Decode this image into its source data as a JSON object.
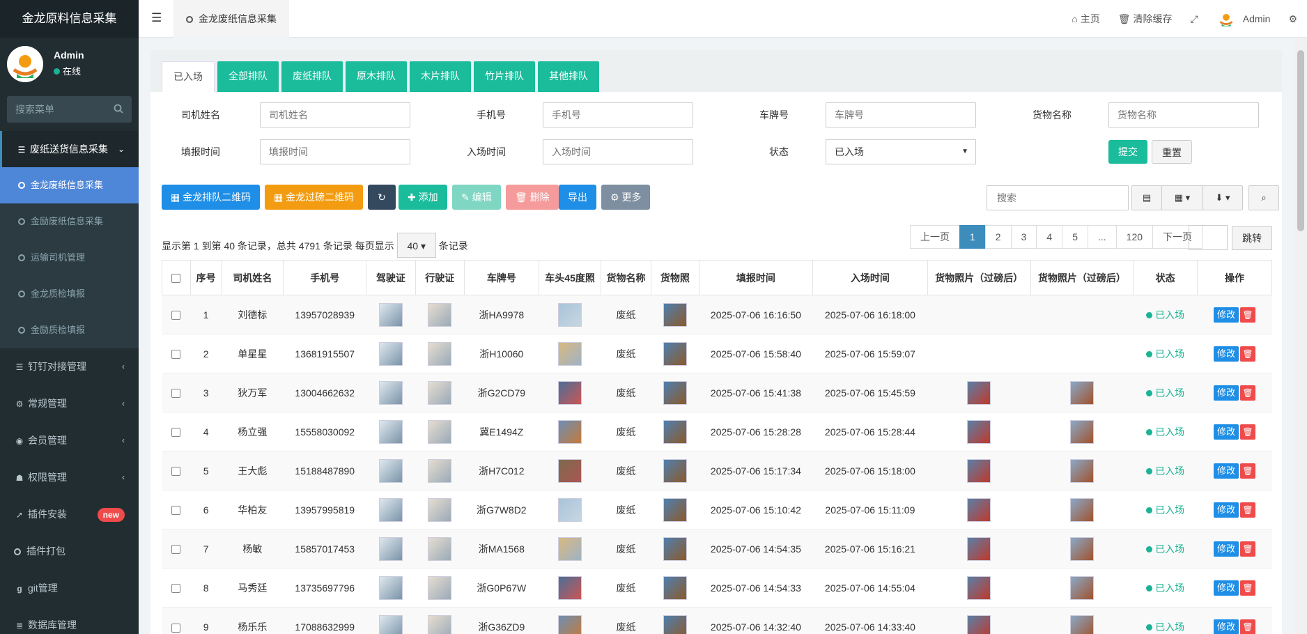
{
  "sidebar": {
    "brand": "金龙原料信息采集",
    "user_name": "Admin",
    "user_status": "在线",
    "search_placeholder": "搜索菜单",
    "active_group": "废纸送货信息采集",
    "sub_items": [
      "金龙废纸信息采集",
      "金励废纸信息采集",
      "运输司机管理",
      "金龙质检填报",
      "金励质检填报"
    ],
    "items": [
      {
        "label": "钉钉对接管理",
        "icon": "list-icon"
      },
      {
        "label": "常规管理",
        "icon": "cogs-icon"
      },
      {
        "label": "会员管理",
        "icon": "user-circle-icon"
      },
      {
        "label": "权限管理",
        "icon": "group-icon"
      },
      {
        "label": "插件安装",
        "icon": "rocket-icon",
        "badge": "new"
      },
      {
        "label": "插件打包",
        "icon": "circle-icon"
      },
      {
        "label": "git管理",
        "icon": "git-icon"
      },
      {
        "label": "数据库管理",
        "icon": "database-icon"
      }
    ]
  },
  "topbar": {
    "tab": "金龙废纸信息采集",
    "home": "主页",
    "clear_cache": "清除缓存",
    "user": "Admin"
  },
  "tabs": [
    "已入场",
    "全部排队",
    "废纸排队",
    "原木排队",
    "木片排队",
    "竹片排队",
    "其他排队"
  ],
  "form": {
    "driver_name": {
      "label": "司机姓名",
      "placeholder": "司机姓名"
    },
    "phone": {
      "label": "手机号",
      "placeholder": "手机号"
    },
    "plate": {
      "label": "车牌号",
      "placeholder": "车牌号"
    },
    "goods": {
      "label": "货物名称",
      "placeholder": "货物名称"
    },
    "report_time": {
      "label": "填报时间",
      "placeholder": "填报时间"
    },
    "entry_time": {
      "label": "入场时间",
      "placeholder": "入场时间"
    },
    "status": {
      "label": "状态",
      "value": "已入场"
    },
    "submit": "提交",
    "reset": "重置"
  },
  "toolbar": {
    "qr_queue": "金龙排队二维码",
    "qr_weigh": "金龙过磅二维码",
    "add": "添加",
    "edit": "编辑",
    "delete": "删除",
    "export": "导出",
    "more": "更多",
    "search_placeholder": "搜索"
  },
  "pagination": {
    "info_prefix": "显示第 1 到第 40 条记录，总共 4791 条记录 每页显示",
    "page_size": "40",
    "info_suffix": "条记录",
    "prev": "上一页",
    "pages": [
      "1",
      "2",
      "3",
      "4",
      "5",
      "...",
      "120"
    ],
    "next": "下一页",
    "jump": "跳转"
  },
  "table": {
    "columns": [
      "序号",
      "司机姓名",
      "手机号",
      "驾驶证",
      "行驶证",
      "车牌号",
      "车头45度照",
      "货物名称",
      "货物照",
      "填报时间",
      "入场时间",
      "货物照片（过磅后）",
      "货物照片（过磅后）",
      "状态",
      "操作"
    ],
    "edit_label": "修改",
    "rows": [
      {
        "no": "1",
        "name": "刘德标",
        "phone": "13957028939",
        "plate": "浙HA9978",
        "goods": "废纸",
        "report": "2025-07-06 16:16:50",
        "entry": "2025-07-06 16:18:00",
        "after": false,
        "status": "已入场"
      },
      {
        "no": "2",
        "name": "单星星",
        "phone": "13681915507",
        "plate": "浙H10060",
        "goods": "废纸",
        "report": "2025-07-06 15:58:40",
        "entry": "2025-07-06 15:59:07",
        "after": false,
        "status": "已入场"
      },
      {
        "no": "3",
        "name": "狄万军",
        "phone": "13004662632",
        "plate": "浙G2CD79",
        "goods": "废纸",
        "report": "2025-07-06 15:41:38",
        "entry": "2025-07-06 15:45:59",
        "after": true,
        "status": "已入场"
      },
      {
        "no": "4",
        "name": "杨立强",
        "phone": "15558030092",
        "plate": "冀E1494Z",
        "goods": "废纸",
        "report": "2025-07-06 15:28:28",
        "entry": "2025-07-06 15:28:44",
        "after": true,
        "status": "已入场"
      },
      {
        "no": "5",
        "name": "王大彪",
        "phone": "15188487890",
        "plate": "浙H7C012",
        "goods": "废纸",
        "report": "2025-07-06 15:17:34",
        "entry": "2025-07-06 15:18:00",
        "after": true,
        "status": "已入场"
      },
      {
        "no": "6",
        "name": "华柏友",
        "phone": "13957995819",
        "plate": "浙G7W8D2",
        "goods": "废纸",
        "report": "2025-07-06 15:10:42",
        "entry": "2025-07-06 15:11:09",
        "after": true,
        "status": "已入场"
      },
      {
        "no": "7",
        "name": "杨敏",
        "phone": "15857017453",
        "plate": "浙MA1568",
        "goods": "废纸",
        "report": "2025-07-06 14:54:35",
        "entry": "2025-07-06 15:16:21",
        "after": true,
        "status": "已入场"
      },
      {
        "no": "8",
        "name": "马秀廷",
        "phone": "13735697796",
        "plate": "浙G0P67W",
        "goods": "废纸",
        "report": "2025-07-06 14:54:33",
        "entry": "2025-07-06 14:55:04",
        "after": true,
        "status": "已入场"
      },
      {
        "no": "9",
        "name": "杨乐乐",
        "phone": "17088632999",
        "plate": "浙G36ZD9",
        "goods": "废纸",
        "report": "2025-07-06 14:32:40",
        "entry": "2025-07-06 14:33:40",
        "after": true,
        "status": "已入场"
      }
    ]
  },
  "colors": {
    "sidebar_bg": "#222d32",
    "active_item": "#4e86d8",
    "tab_green": "#1abc9c",
    "primary_blue": "#1e8ee6",
    "orange": "#f39c12",
    "danger": "#f04b4b",
    "status_green": "#1ab394"
  }
}
